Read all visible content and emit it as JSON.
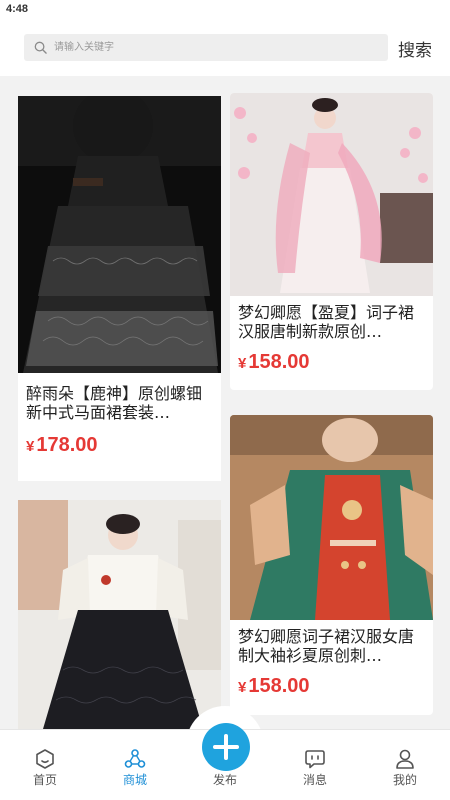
{
  "status_bar": {
    "time": "4:48"
  },
  "search": {
    "placeholder": "请输入关键字",
    "button_label": "搜索"
  },
  "products": [
    {
      "title": "醉雨朵【鹿神】原创螺钿新中式马面裙套装…",
      "currency": "¥",
      "price": "178.00",
      "image": "black-mamian-skirt-photo"
    },
    {
      "title": "梦幻卿愿【盈夏】词子裙汉服唐制新款原创…",
      "currency": "¥",
      "price": "158.00",
      "image": "pink-tang-hanfu-photo"
    },
    {
      "title": "梦幻卿愿词子裙汉服女唐制大袖衫夏原创刺…",
      "currency": "¥",
      "price": "158.00",
      "image": "green-red-tang-hanfu-photo"
    },
    {
      "title": "",
      "currency": "",
      "price": "",
      "image": "white-top-black-skirt-photo"
    }
  ],
  "tabbar": {
    "items": [
      {
        "label": "首页",
        "icon": "home-icon",
        "active": false
      },
      {
        "label": "商城",
        "icon": "mall-icon",
        "active": true
      },
      {
        "label": "发布",
        "icon": "plus-icon",
        "active": false
      },
      {
        "label": "消息",
        "icon": "message-icon",
        "active": false
      },
      {
        "label": "我的",
        "icon": "profile-icon",
        "active": false
      }
    ]
  },
  "colors": {
    "accent": "#1e8fd6",
    "price": "#e53935",
    "publish": "#1fa3de"
  }
}
